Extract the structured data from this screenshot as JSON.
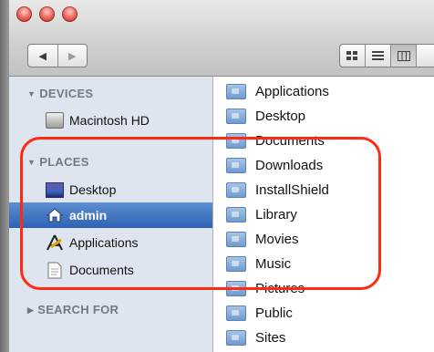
{
  "window": {
    "traffic_lights": [
      "close",
      "minimize",
      "zoom"
    ],
    "nav": {
      "back_icon": "◀",
      "forward_icon": "▶"
    },
    "view_modes": [
      "icon-view",
      "list-view",
      "column-view"
    ]
  },
  "sidebar": {
    "devices_label": "DEVICES",
    "devices": [
      {
        "label": "Macintosh HD",
        "icon": "hard-drive-icon"
      }
    ],
    "places_label": "PLACES",
    "places": [
      {
        "label": "Desktop",
        "icon": "desktop-icon"
      },
      {
        "label": "admin",
        "icon": "home-icon",
        "selected": true
      },
      {
        "label": "Applications",
        "icon": "applications-icon"
      },
      {
        "label": "Documents",
        "icon": "document-icon"
      }
    ],
    "search_label": "SEARCH FOR"
  },
  "files": [
    "Applications",
    "Desktop",
    "Documents",
    "Downloads",
    "InstallShield",
    "Library",
    "Movies",
    "Music",
    "Pictures",
    "Public",
    "Sites"
  ],
  "colors": {
    "selection": "#3c6fc0",
    "highlight": "#ff2a12",
    "sidebar": "#dfe5ee"
  }
}
